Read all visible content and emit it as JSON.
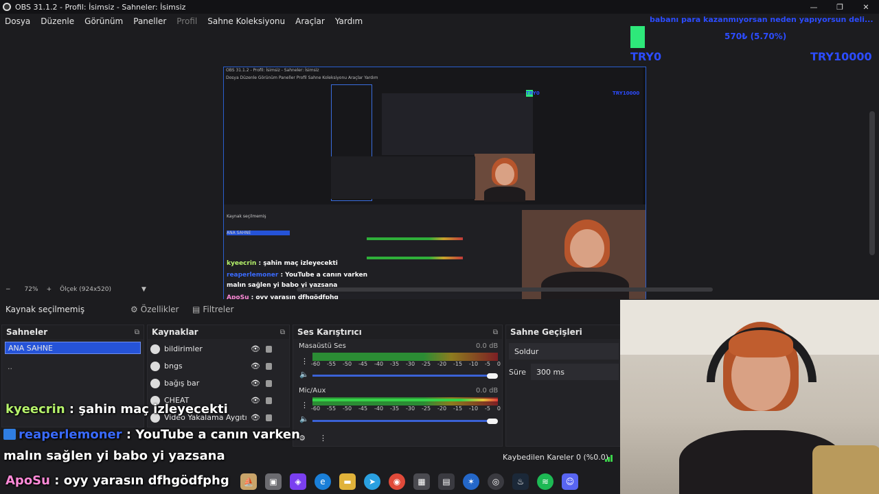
{
  "window": {
    "title": "OBS 31.1.2 - Profil: İsimsiz - Sahneler: İsimsiz"
  },
  "menu": {
    "items": [
      {
        "label": "Dosya",
        "disabled": false
      },
      {
        "label": "Düzenle",
        "disabled": false
      },
      {
        "label": "Görünüm",
        "disabled": false
      },
      {
        "label": "Paneller",
        "disabled": false
      },
      {
        "label": "Profil",
        "disabled": true
      },
      {
        "label": "Sahne Koleksiyonu",
        "disabled": false
      },
      {
        "label": "Araçlar",
        "disabled": false
      },
      {
        "label": "Yardım",
        "disabled": false
      }
    ]
  },
  "overlay": {
    "donation_text": "babanı para kazanmıyorsan neden yapıyorsun deli...",
    "goal_percent": "570₺ (5.70%)",
    "goal_start": "TRY0",
    "goal_end": "TRY10000",
    "goal_progress": 0.057
  },
  "zoom": {
    "level": "72%",
    "scale_label": "Ölçek (924x520)"
  },
  "source_toolbar": {
    "no_source": "Kaynak seçilmemiş",
    "properties": "Özellikler",
    "filters": "Filtreler"
  },
  "scenes": {
    "title": "Sahneler",
    "items": [
      "ANA SAHNE"
    ],
    "more": ".."
  },
  "sources": {
    "title": "Kaynaklar",
    "items": [
      "bildirimler",
      "bngs",
      "bağış bar",
      "CHEAT",
      "Video Yakalama Aygıtı"
    ]
  },
  "mixer": {
    "title": "Ses Karıştırıcı",
    "channels": [
      {
        "name": "Masaüstü Ses",
        "db": "0.0 dB"
      },
      {
        "name": "Mic/Aux",
        "db": "0.0 dB"
      }
    ],
    "scale": [
      "-60",
      "-55",
      "-50",
      "-45",
      "-40",
      "-35",
      "-30",
      "-25",
      "-20",
      "-15",
      "-10",
      "-5",
      "0"
    ]
  },
  "transitions": {
    "title": "Sahne Geçişleri",
    "type": "Soldur",
    "duration_label": "Süre",
    "duration_value": "300 ms"
  },
  "status": {
    "dropped_frames": "Kaybedilen Kareler 0 (%0.0)"
  },
  "chat": [
    {
      "user": "kyeecrin",
      "message": " : şahin maç izleyecekti"
    },
    {
      "user": "reaperlemoner",
      "message": " : YouTube a canın varken"
    },
    {
      "user": "",
      "message": "malın sağlen yi babo yi yazsana"
    },
    {
      "user": "ApoSu",
      "message": " : oyy yarasın dfhgödfphg"
    }
  ],
  "nested": {
    "title": "OBS 31.1.2 - Profil: İsimsiz - Sahneler: İsimsiz",
    "menu": "Dosya  Düzenle  Görünüm  Paneller  Profil  Sahne Koleksiyonu  Araçlar  Yardım",
    "no_source": "Kaynak seçilmemiş",
    "scene": "ANA SAHNE",
    "chat1_user": "kyeecrin",
    "chat1_msg": " : şahin maç izleyecekti",
    "chat2_user": "reaperlemoner",
    "chat2_msg": " : YouTube a canın varken",
    "chat3": "malın sağlen yi babo yi yazsana",
    "chat4_user": "ApoSu",
    "chat4_msg": " : oyy yarasın dfhgödfphg",
    "goal_start": "TRY0",
    "goal_end": "TRY10000"
  },
  "colors": {
    "accent": "#2553d8",
    "chat_user1": "#b6f36b",
    "chat_user2": "#3a6bff",
    "chat_user3": "#ff8ad8",
    "goal": "#2c4cff"
  }
}
